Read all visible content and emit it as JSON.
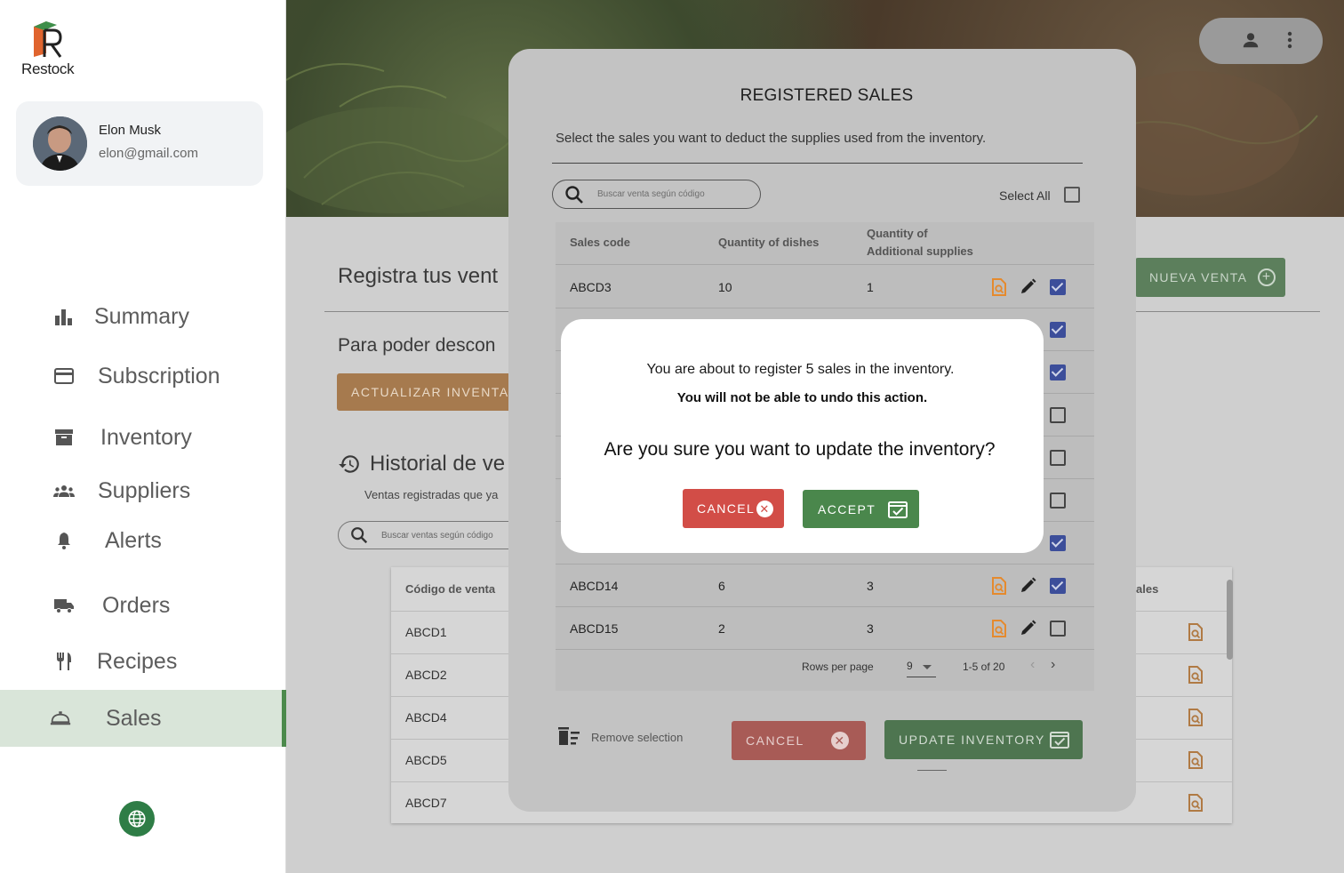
{
  "app": {
    "name": "Restock"
  },
  "user": {
    "name": "Elon Musk",
    "email": "elon@gmail.com"
  },
  "sidebar": {
    "items": [
      {
        "label": "Summary",
        "icon": "bar-chart-icon",
        "active": false
      },
      {
        "label": "Subscription",
        "icon": "credit-card-icon",
        "active": false
      },
      {
        "label": "Inventory",
        "icon": "archive-box-icon",
        "active": false
      },
      {
        "label": "Suppliers",
        "icon": "group-icon",
        "active": false
      },
      {
        "label": "Alerts",
        "icon": "bell-icon",
        "active": false
      },
      {
        "label": "Orders",
        "icon": "truck-icon",
        "active": false
      },
      {
        "label": "Recipes",
        "icon": "utensils-icon",
        "active": false
      },
      {
        "label": "Sales",
        "icon": "room-service-icon",
        "active": true
      }
    ]
  },
  "page": {
    "title": "Registra tus vent",
    "new_sale_button": "NUEVA VENTA",
    "subtitle": "Para poder descon",
    "update_button": "ACTUALIZAR INVENTAR",
    "history_title": "Historial de ve",
    "history_subtitle": "Ventas registradas que ya",
    "search_placeholder": "Buscar ventas según código",
    "table": {
      "col_code": "Código de venta",
      "col_last": "ales",
      "rows": [
        "ABCD1",
        "ABCD2",
        "ABCD4",
        "ABCD5",
        "ABCD7"
      ]
    }
  },
  "sales_modal": {
    "title": "REGISTERED SALES",
    "description": "Select the sales you want to deduct the supplies used from the inventory.",
    "search_placeholder": "Buscar venta según código",
    "select_all": "Select All",
    "columns": {
      "code": "Sales code",
      "dishes": "Quantity  of dishes",
      "supplies_line1": "Quantity of",
      "supplies_line2": "Additional supplies"
    },
    "rows": [
      {
        "code": "ABCD3",
        "dishes": "10",
        "supplies": "1",
        "checked": true
      },
      {
        "code": "",
        "dishes": "",
        "supplies": "",
        "checked": true
      },
      {
        "code": "",
        "dishes": "",
        "supplies": "",
        "checked": true
      },
      {
        "code": "",
        "dishes": "",
        "supplies": "",
        "checked": false
      },
      {
        "code": "",
        "dishes": "",
        "supplies": "",
        "checked": false
      },
      {
        "code": "",
        "dishes": "",
        "supplies": "",
        "checked": false
      },
      {
        "code": "",
        "dishes": "",
        "supplies": "",
        "checked": true
      },
      {
        "code": "ABCD14",
        "dishes": "6",
        "supplies": "3",
        "checked": true
      },
      {
        "code": "ABCD15",
        "dishes": "2",
        "supplies": "3",
        "checked": false
      }
    ],
    "rows_per_page_label": "Rows per page",
    "rows_per_page_value": "9",
    "range": "1-5 of 20",
    "remove_selection": "Remove selection",
    "cancel": "CANCEL",
    "update": "UPDATE INVENTORY"
  },
  "confirm_dialog": {
    "line1": "You are about to register 5 sales in the inventory.",
    "line2": "You will not be able to undo this action.",
    "question": "Are you sure you want to update the inventory?",
    "cancel": "CANCEL",
    "accept": "ACCEPT"
  },
  "colors": {
    "accent_green": "#4a874c",
    "danger_red": "#d24d47",
    "checkbox_blue": "#3f51b5",
    "orange_icon": "#e58a2e"
  }
}
